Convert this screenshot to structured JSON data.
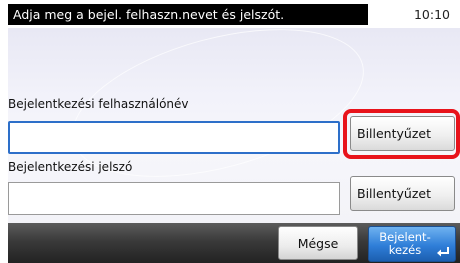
{
  "header": {
    "title": "Adja meg a bejel. felhaszn.nevet és jelszót.",
    "time": "10:10"
  },
  "form": {
    "username_label": "Bejelentkezési felhasználónév",
    "username_value": "",
    "password_label": "Bejelentkezési jelszó",
    "password_value": "",
    "keyboard_label_user": "Billentyűzet",
    "keyboard_label_pass": "Billentyűzet"
  },
  "footer": {
    "cancel_label": "Mégse",
    "login_label_line1": "Bejelent-",
    "login_label_line2": "kezés",
    "login_icon": "enter-icon"
  },
  "colors": {
    "highlight": "#e8131b",
    "login_button": "#2f7ed8",
    "input_focus": "#2d6fc9"
  }
}
